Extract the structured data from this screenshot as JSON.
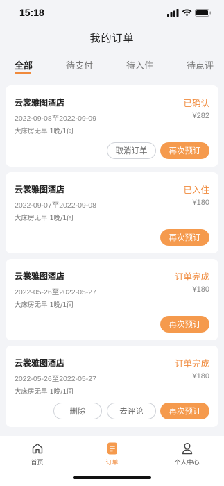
{
  "status_bar": {
    "time": "15:18"
  },
  "header": {
    "title": "我的订单"
  },
  "tabs": [
    {
      "label": "全部",
      "active": true
    },
    {
      "label": "待支付",
      "active": false
    },
    {
      "label": "待入住",
      "active": false
    },
    {
      "label": "待点评",
      "active": false
    }
  ],
  "orders": [
    {
      "hotel": "云裳雅图酒店",
      "status": "已确认",
      "dates": "2022-09-08至2022-09-09",
      "price": "¥282",
      "room": "大床房无早  1晚/1间",
      "actions": {
        "cancel": "取消订单",
        "rebook": "再次预订"
      }
    },
    {
      "hotel": "云裳雅图酒店",
      "status": "已入住",
      "dates": "2022-09-07至2022-09-08",
      "price": "¥180",
      "room": "大床房无早  1晚/1间",
      "actions": {
        "rebook": "再次预订"
      }
    },
    {
      "hotel": "云裳雅图酒店",
      "status": "订单完成",
      "dates": "2022-05-26至2022-05-27",
      "price": "¥180",
      "room": "大床房无早  1晚/1间",
      "actions": {
        "rebook": "再次预订"
      }
    },
    {
      "hotel": "云裳雅图酒店",
      "status": "订单完成",
      "dates": "2022-05-26至2022-05-27",
      "price": "¥180",
      "room": "大床房无早  1晚/1间",
      "actions": {
        "delete": "删除",
        "review": "去评论",
        "rebook": "再次预订"
      }
    }
  ],
  "bottom_nav": [
    {
      "label": "首页",
      "icon": "home-icon",
      "active": false
    },
    {
      "label": "订单",
      "icon": "order-icon",
      "active": true
    },
    {
      "label": "个人中心",
      "icon": "user-icon",
      "active": false
    }
  ],
  "colors": {
    "accent": "#f08a3c",
    "button": "#f59a4d",
    "background": "#f3f4f7"
  }
}
